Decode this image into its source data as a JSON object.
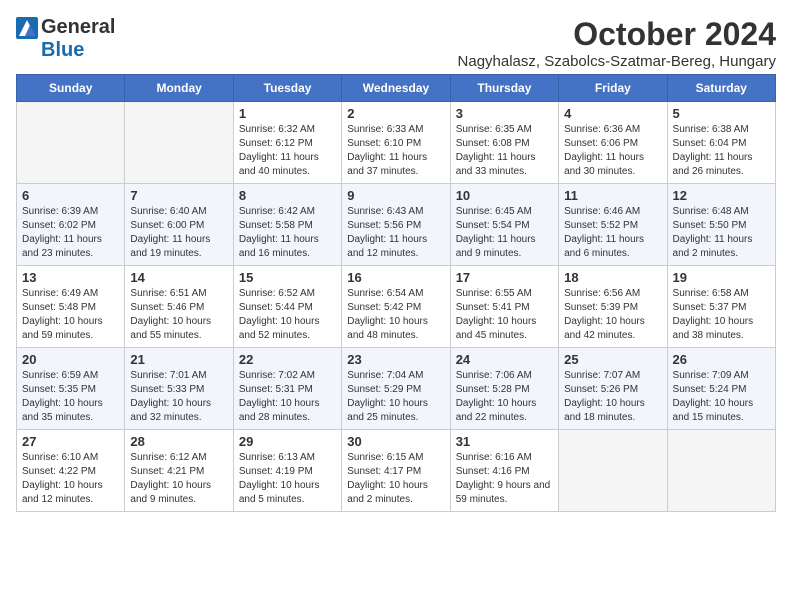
{
  "header": {
    "logo_general": "General",
    "logo_blue": "Blue",
    "month_title": "October 2024",
    "location": "Nagyhalasz, Szabolcs-Szatmar-Bereg, Hungary"
  },
  "days_of_week": [
    "Sunday",
    "Monday",
    "Tuesday",
    "Wednesday",
    "Thursday",
    "Friday",
    "Saturday"
  ],
  "weeks": [
    {
      "days": [
        {
          "number": "",
          "info": ""
        },
        {
          "number": "",
          "info": ""
        },
        {
          "number": "1",
          "info": "Sunrise: 6:32 AM\nSunset: 6:12 PM\nDaylight: 11 hours and 40 minutes."
        },
        {
          "number": "2",
          "info": "Sunrise: 6:33 AM\nSunset: 6:10 PM\nDaylight: 11 hours and 37 minutes."
        },
        {
          "number": "3",
          "info": "Sunrise: 6:35 AM\nSunset: 6:08 PM\nDaylight: 11 hours and 33 minutes."
        },
        {
          "number": "4",
          "info": "Sunrise: 6:36 AM\nSunset: 6:06 PM\nDaylight: 11 hours and 30 minutes."
        },
        {
          "number": "5",
          "info": "Sunrise: 6:38 AM\nSunset: 6:04 PM\nDaylight: 11 hours and 26 minutes."
        }
      ]
    },
    {
      "days": [
        {
          "number": "6",
          "info": "Sunrise: 6:39 AM\nSunset: 6:02 PM\nDaylight: 11 hours and 23 minutes."
        },
        {
          "number": "7",
          "info": "Sunrise: 6:40 AM\nSunset: 6:00 PM\nDaylight: 11 hours and 19 minutes."
        },
        {
          "number": "8",
          "info": "Sunrise: 6:42 AM\nSunset: 5:58 PM\nDaylight: 11 hours and 16 minutes."
        },
        {
          "number": "9",
          "info": "Sunrise: 6:43 AM\nSunset: 5:56 PM\nDaylight: 11 hours and 12 minutes."
        },
        {
          "number": "10",
          "info": "Sunrise: 6:45 AM\nSunset: 5:54 PM\nDaylight: 11 hours and 9 minutes."
        },
        {
          "number": "11",
          "info": "Sunrise: 6:46 AM\nSunset: 5:52 PM\nDaylight: 11 hours and 6 minutes."
        },
        {
          "number": "12",
          "info": "Sunrise: 6:48 AM\nSunset: 5:50 PM\nDaylight: 11 hours and 2 minutes."
        }
      ]
    },
    {
      "days": [
        {
          "number": "13",
          "info": "Sunrise: 6:49 AM\nSunset: 5:48 PM\nDaylight: 10 hours and 59 minutes."
        },
        {
          "number": "14",
          "info": "Sunrise: 6:51 AM\nSunset: 5:46 PM\nDaylight: 10 hours and 55 minutes."
        },
        {
          "number": "15",
          "info": "Sunrise: 6:52 AM\nSunset: 5:44 PM\nDaylight: 10 hours and 52 minutes."
        },
        {
          "number": "16",
          "info": "Sunrise: 6:54 AM\nSunset: 5:42 PM\nDaylight: 10 hours and 48 minutes."
        },
        {
          "number": "17",
          "info": "Sunrise: 6:55 AM\nSunset: 5:41 PM\nDaylight: 10 hours and 45 minutes."
        },
        {
          "number": "18",
          "info": "Sunrise: 6:56 AM\nSunset: 5:39 PM\nDaylight: 10 hours and 42 minutes."
        },
        {
          "number": "19",
          "info": "Sunrise: 6:58 AM\nSunset: 5:37 PM\nDaylight: 10 hours and 38 minutes."
        }
      ]
    },
    {
      "days": [
        {
          "number": "20",
          "info": "Sunrise: 6:59 AM\nSunset: 5:35 PM\nDaylight: 10 hours and 35 minutes."
        },
        {
          "number": "21",
          "info": "Sunrise: 7:01 AM\nSunset: 5:33 PM\nDaylight: 10 hours and 32 minutes."
        },
        {
          "number": "22",
          "info": "Sunrise: 7:02 AM\nSunset: 5:31 PM\nDaylight: 10 hours and 28 minutes."
        },
        {
          "number": "23",
          "info": "Sunrise: 7:04 AM\nSunset: 5:29 PM\nDaylight: 10 hours and 25 minutes."
        },
        {
          "number": "24",
          "info": "Sunrise: 7:06 AM\nSunset: 5:28 PM\nDaylight: 10 hours and 22 minutes."
        },
        {
          "number": "25",
          "info": "Sunrise: 7:07 AM\nSunset: 5:26 PM\nDaylight: 10 hours and 18 minutes."
        },
        {
          "number": "26",
          "info": "Sunrise: 7:09 AM\nSunset: 5:24 PM\nDaylight: 10 hours and 15 minutes."
        }
      ]
    },
    {
      "days": [
        {
          "number": "27",
          "info": "Sunrise: 6:10 AM\nSunset: 4:22 PM\nDaylight: 10 hours and 12 minutes."
        },
        {
          "number": "28",
          "info": "Sunrise: 6:12 AM\nSunset: 4:21 PM\nDaylight: 10 hours and 9 minutes."
        },
        {
          "number": "29",
          "info": "Sunrise: 6:13 AM\nSunset: 4:19 PM\nDaylight: 10 hours and 5 minutes."
        },
        {
          "number": "30",
          "info": "Sunrise: 6:15 AM\nSunset: 4:17 PM\nDaylight: 10 hours and 2 minutes."
        },
        {
          "number": "31",
          "info": "Sunrise: 6:16 AM\nSunset: 4:16 PM\nDaylight: 9 hours and 59 minutes."
        },
        {
          "number": "",
          "info": ""
        },
        {
          "number": "",
          "info": ""
        }
      ]
    }
  ]
}
